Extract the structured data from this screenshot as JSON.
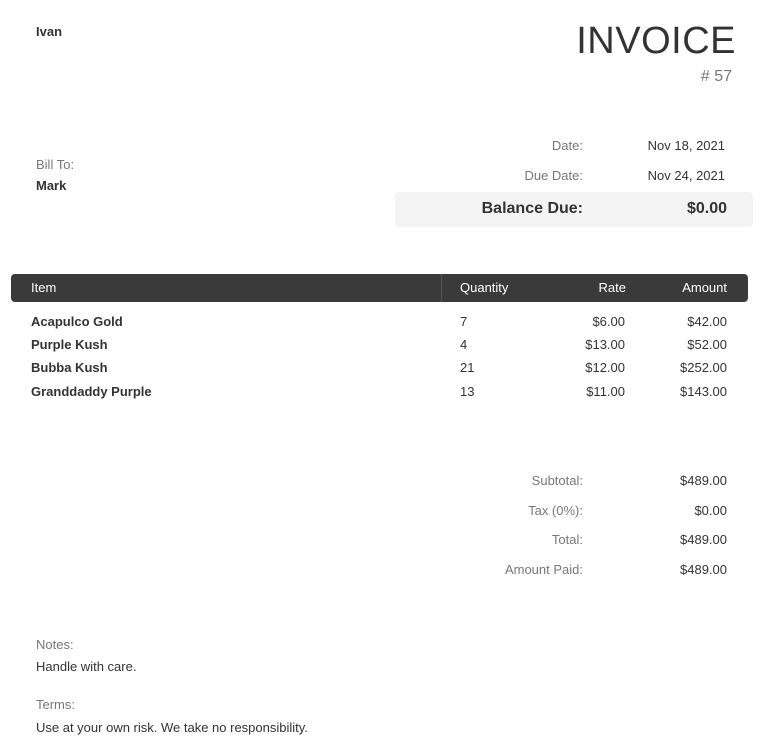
{
  "from": {
    "name": "Ivan"
  },
  "invoice": {
    "title": "INVOICE",
    "number": "# 57"
  },
  "bill_to": {
    "label": "Bill To:",
    "name": "Mark"
  },
  "meta": {
    "date_label": "Date:",
    "date_value": "Nov 18, 2021",
    "due_label": "Due Date:",
    "due_value": "Nov 24, 2021",
    "balance_label": "Balance Due:",
    "balance_value": "$0.00"
  },
  "table": {
    "headers": {
      "item": "Item",
      "quantity": "Quantity",
      "rate": "Rate",
      "amount": "Amount"
    },
    "rows": [
      {
        "item": "Acapulco Gold",
        "quantity": "7",
        "rate": "$6.00",
        "amount": "$42.00"
      },
      {
        "item": "Purple Kush",
        "quantity": "4",
        "rate": "$13.00",
        "amount": "$52.00"
      },
      {
        "item": "Bubba Kush",
        "quantity": "21",
        "rate": "$12.00",
        "amount": "$252.00"
      },
      {
        "item": "Granddaddy Purple",
        "quantity": "13",
        "rate": "$11.00",
        "amount": "$143.00"
      }
    ]
  },
  "totals": {
    "subtotal_label": "Subtotal:",
    "subtotal_value": "$489.00",
    "tax_label": "Tax (0%):",
    "tax_value": "$0.00",
    "total_label": "Total:",
    "total_value": "$489.00",
    "paid_label": "Amount Paid:",
    "paid_value": "$489.00"
  },
  "notes": {
    "label": "Notes:",
    "text": "Handle with care."
  },
  "terms": {
    "label": "Terms:",
    "text": "Use at your own risk. We take no responsibility."
  }
}
